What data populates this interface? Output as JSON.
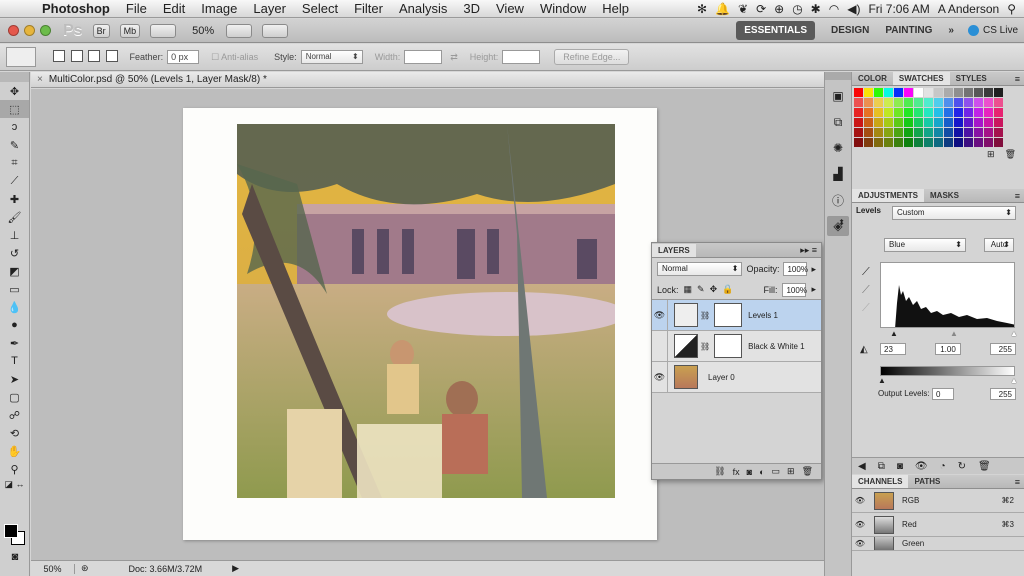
{
  "menubar": {
    "apple": "",
    "app_name": "Photoshop",
    "menus": [
      "File",
      "Edit",
      "Image",
      "Layer",
      "Select",
      "Filter",
      "Analysis",
      "3D",
      "View",
      "Window",
      "Help"
    ],
    "clock": "Fri 7:06 AM",
    "user": "A Anderson"
  },
  "appbar": {
    "logo": "Ps",
    "br_label": "Br",
    "mb_label": "Mb",
    "zoom": "50%",
    "workspaces": [
      "ESSENTIALS",
      "DESIGN",
      "PAINTING"
    ],
    "more": "»",
    "cs_live": "CS Live"
  },
  "options": {
    "feather_label": "Feather:",
    "feather_value": "0 px",
    "antialias_label": "Anti-alias",
    "style_label": "Style:",
    "style_value": "Normal",
    "width_label": "Width:",
    "height_label": "Height:",
    "refine_edge": "Refine Edge..."
  },
  "document": {
    "tab_title": "MultiColor.psd @ 50% (Levels 1, Layer Mask/8) *",
    "close": "×"
  },
  "status": {
    "zoom": "50%",
    "doc_info": "Doc: 3.66M/3.72M"
  },
  "layers_panel": {
    "title": "LAYERS",
    "blend_mode": "Normal",
    "opacity_label": "Opacity:",
    "opacity_value": "100%",
    "lock_label": "Lock:",
    "fill_label": "Fill:",
    "fill_value": "100%",
    "layers": [
      {
        "name": "Levels 1",
        "visible": true,
        "selected": true
      },
      {
        "name": "Black & White 1",
        "visible": false,
        "selected": false
      },
      {
        "name": "Layer 0",
        "visible": true,
        "selected": false
      }
    ]
  },
  "color_panel": {
    "tabs": [
      "COLOR",
      "SWATCHES",
      "STYLES"
    ],
    "active_tab": "SWATCHES"
  },
  "adjustments_panel": {
    "tabs": [
      "ADJUSTMENTS",
      "MASKS"
    ],
    "preset_label": "Levels",
    "preset_value": "Custom",
    "channel_value": "Blue",
    "auto_label": "Auto",
    "input_black": "23",
    "input_gamma": "1.00",
    "input_white": "255",
    "output_label": "Output Levels:",
    "output_black": "0",
    "output_white": "255"
  },
  "channels_panel": {
    "tabs": [
      "CHANNELS",
      "PATHS"
    ],
    "channels": [
      {
        "name": "RGB",
        "shortcut": "⌘2"
      },
      {
        "name": "Red",
        "shortcut": "⌘3"
      },
      {
        "name": "Green",
        "shortcut": ""
      }
    ]
  },
  "colors": {
    "selected_layer": "#bcd3ee",
    "panel_bg": "#d4d4d4",
    "canvas_bg": "#bdbdbd"
  }
}
